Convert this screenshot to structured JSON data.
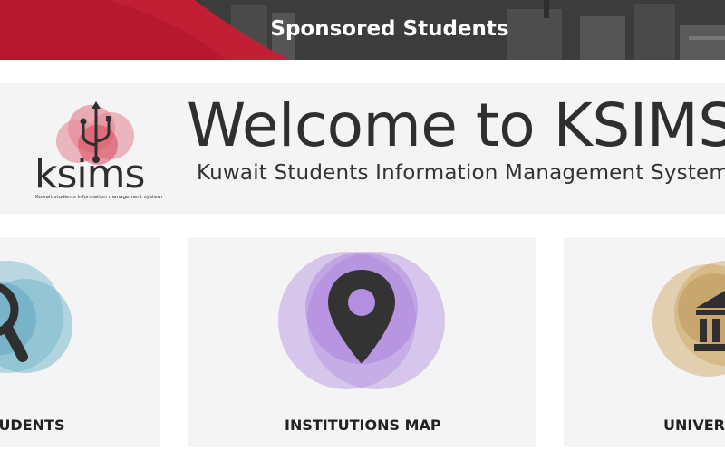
{
  "banner": {
    "title": "Sponsored Students"
  },
  "welcome": {
    "title": "Welcome to KSIMS",
    "subtitle": "Kuwait Students Information Management System"
  },
  "logo": {
    "text": "ksims",
    "tagline": "Kuwait students information management system"
  },
  "cards": [
    {
      "label": "STUDENTS",
      "icon": "magnifier-icon",
      "color": "#6fb3c9"
    },
    {
      "label": "INSTITUTIONS MAP",
      "icon": "map-pin-icon",
      "color": "#b48ee0"
    },
    {
      "label": "UNIVERSITIES",
      "icon": "building-icon",
      "color": "#c9a25a"
    }
  ],
  "colors": {
    "banner_red": "#b8182e",
    "banner_dark": "#3a3a3a",
    "panel": "#f4f4f4",
    "text": "#2f2f2f"
  }
}
